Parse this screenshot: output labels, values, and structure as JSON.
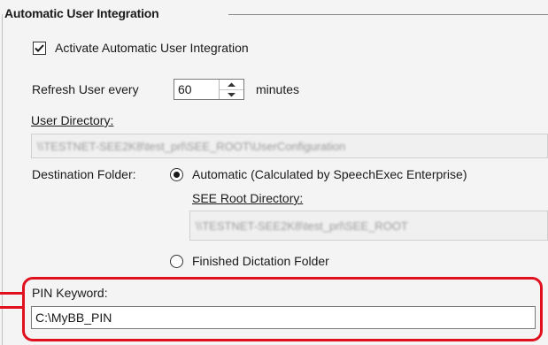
{
  "group": {
    "title": "Automatic User Integration"
  },
  "activate": {
    "label": "Activate Automatic User Integration",
    "checked": true
  },
  "refresh": {
    "label": "Refresh User every",
    "value": "60",
    "unit": "minutes"
  },
  "user_directory": {
    "label": "User Directory:",
    "value": "\\\\TESTNET-SEE2K8\\test_prl\\SEE_ROOT\\UserConfiguration"
  },
  "destination": {
    "label": "Destination Folder:",
    "automatic_label": "Automatic (Calculated by SpeechExec Enterprise)",
    "automatic_selected": true,
    "see_root_label": "SEE Root Directory:",
    "see_root_value": "\\\\TESTNET-SEE2K8\\test_prl\\SEE_ROOT",
    "finished_label": "Finished Dictation Folder",
    "finished_selected": false
  },
  "pin": {
    "label": "PIN Keyword:",
    "value": "C:\\MyBB_PIN"
  },
  "colors": {
    "highlight": "#e0101e"
  }
}
